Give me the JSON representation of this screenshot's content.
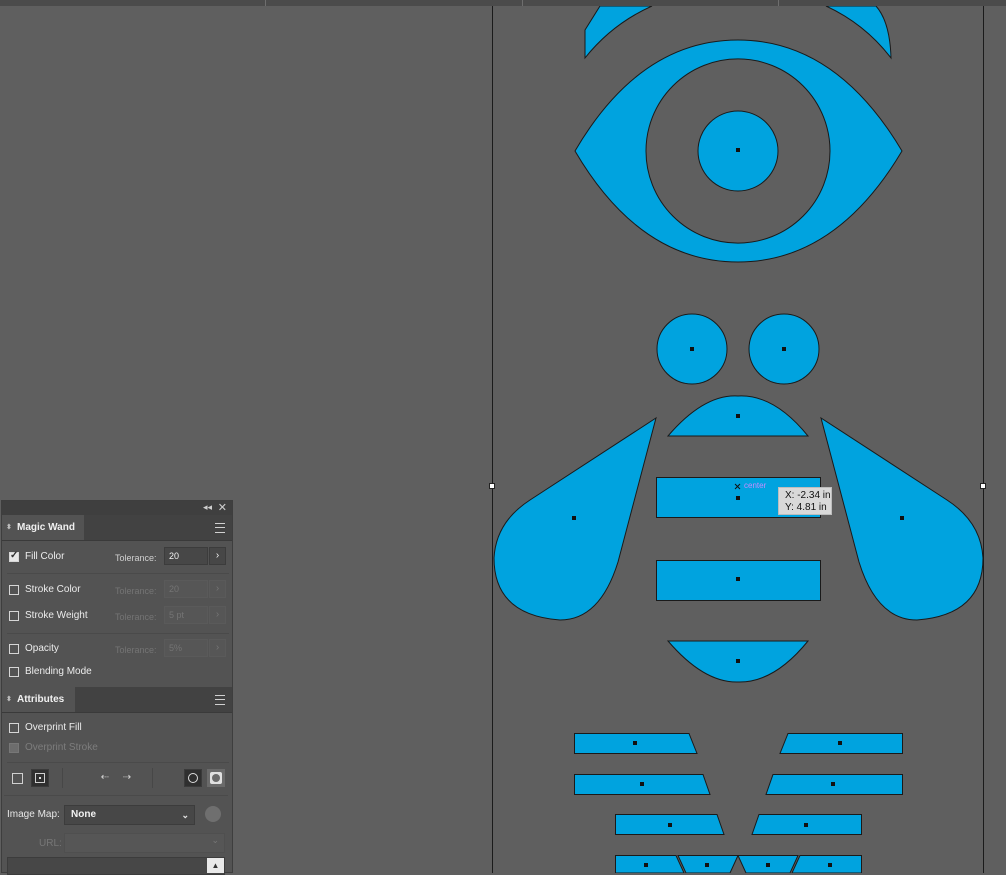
{
  "colors": {
    "artboard_bg": "#5f5f5f",
    "shape_fill": "#00a3df",
    "shape_stroke": "#1a1a1a",
    "panel_bg": "#535353"
  },
  "tooltip": {
    "x_text": "X: -2.34 in",
    "y_text": "Y: 4.81 in",
    "center_hint": "center"
  },
  "magic_wand": {
    "tab_label": "Magic Wand",
    "fill_color": {
      "label": "Fill Color",
      "checked": true,
      "tolerance_label": "Tolerance:",
      "tolerance_value": "20"
    },
    "stroke_color": {
      "label": "Stroke Color",
      "checked": false,
      "tolerance_label": "Tolerance:",
      "tolerance_value": "20"
    },
    "stroke_weight": {
      "label": "Stroke Weight",
      "checked": false,
      "tolerance_label": "Tolerance:",
      "tolerance_value": "5 pt"
    },
    "opacity": {
      "label": "Opacity",
      "checked": false,
      "tolerance_label": "Tolerance:",
      "tolerance_value": "5%"
    },
    "blending_mode": {
      "label": "Blending Mode",
      "checked": false
    }
  },
  "attributes": {
    "tab_label": "Attributes",
    "overprint_fill": {
      "label": "Overprint Fill",
      "checked": false
    },
    "overprint_stroke": {
      "label": "Overprint Stroke",
      "checked": false,
      "disabled": true
    },
    "image_map_label": "Image Map:",
    "image_map_value": "None",
    "url_label": "URL:"
  },
  "icons": {
    "collapse": "double-chevron-left-icon",
    "close": "close-icon",
    "menu": "hamburger-menu-icon",
    "globe": "globe-icon"
  }
}
